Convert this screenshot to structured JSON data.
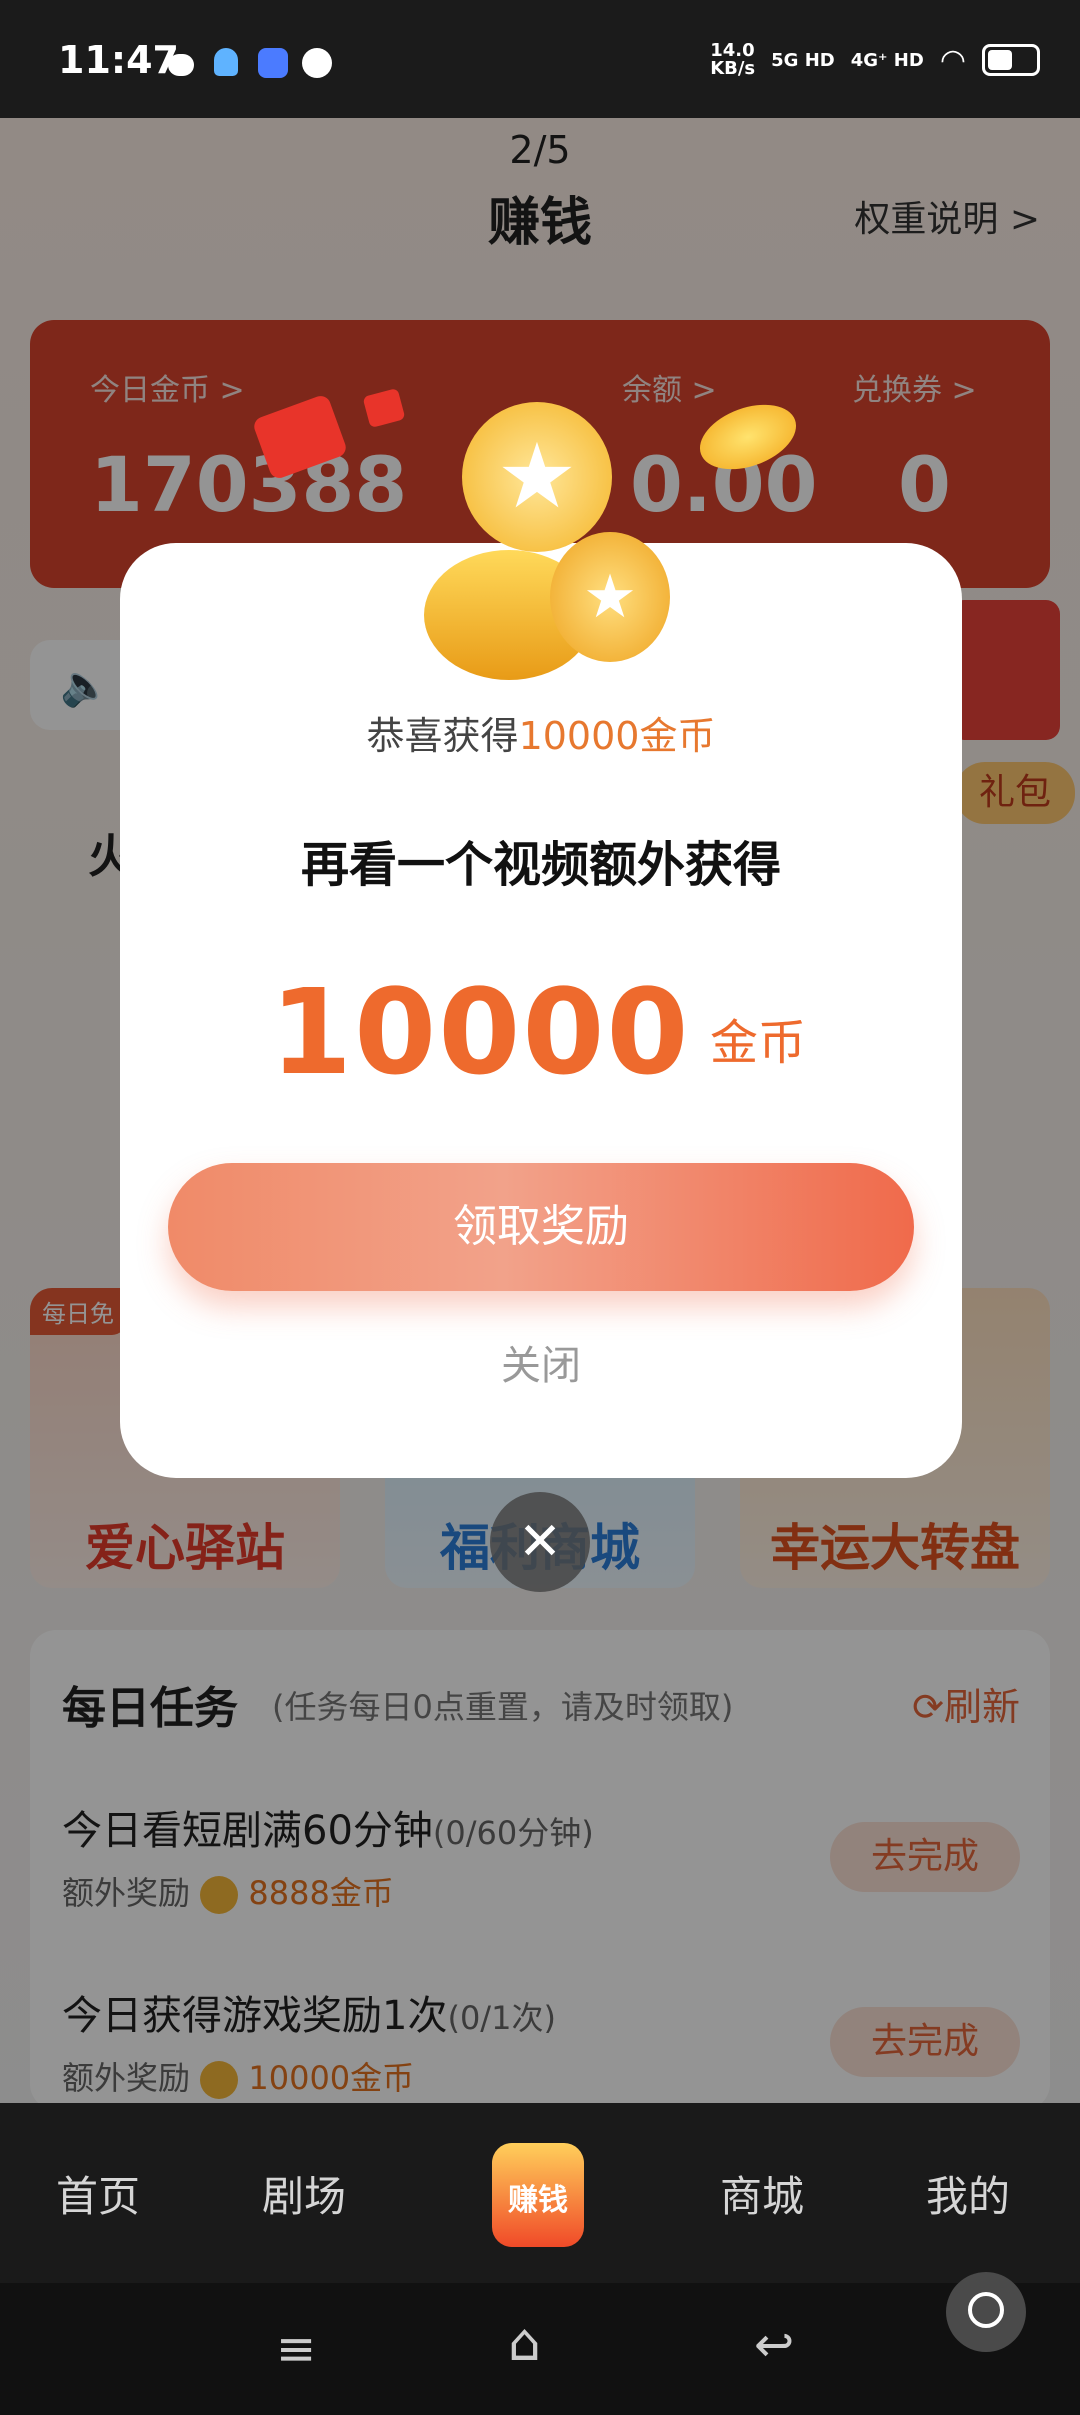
{
  "status_bar": {
    "time": "11:47",
    "net_speed": "14.0\nKB/s",
    "signal1": "5G HD",
    "signal2": "4G⁺ HD"
  },
  "page": {
    "pager": "2/5",
    "title": "赚钱",
    "weight_link": "权重说明 >"
  },
  "stats": {
    "today_label": "今日金币 >",
    "today_value": "170388",
    "balance_label": "余额 >",
    "balance_value": "0.00",
    "coupon_label": "兑换券 >",
    "coupon_value": "0"
  },
  "partial": {
    "gift_tag": "礼包",
    "left_char": "火",
    "daily_tag": "每日免"
  },
  "cards": [
    {
      "title": "爱心驿站"
    },
    {
      "title": "福利商城"
    },
    {
      "title": "幸运大转盘"
    }
  ],
  "tasks": {
    "heading": "每日任务",
    "note": "(任务每日0点重置，请及时领取)",
    "refresh": "刷新",
    "items": [
      {
        "title": "今日看短剧满60分钟",
        "progress": "(0/60分钟)",
        "reward_label": "额外奖励",
        "reward": "8888金币",
        "button": "去完成"
      },
      {
        "title": "今日获得游戏奖励1次",
        "progress": "(0/1次)",
        "reward_label": "额外奖励",
        "reward": "10000金币",
        "button": "去完成"
      }
    ]
  },
  "modal": {
    "congrats_prefix": "恭喜获得",
    "congrats_amount": "10000金币",
    "headline": "再看一个视频额外获得",
    "amount": "10000",
    "unit": "金币",
    "claim_button": "领取奖励",
    "close_text": "关闭"
  },
  "bottom_nav": {
    "items": [
      "首页",
      "剧场",
      "赚钱",
      "商城",
      "我的"
    ]
  },
  "colors": {
    "accent": "#ee6a2d",
    "stats_bg": "#d9442e"
  }
}
